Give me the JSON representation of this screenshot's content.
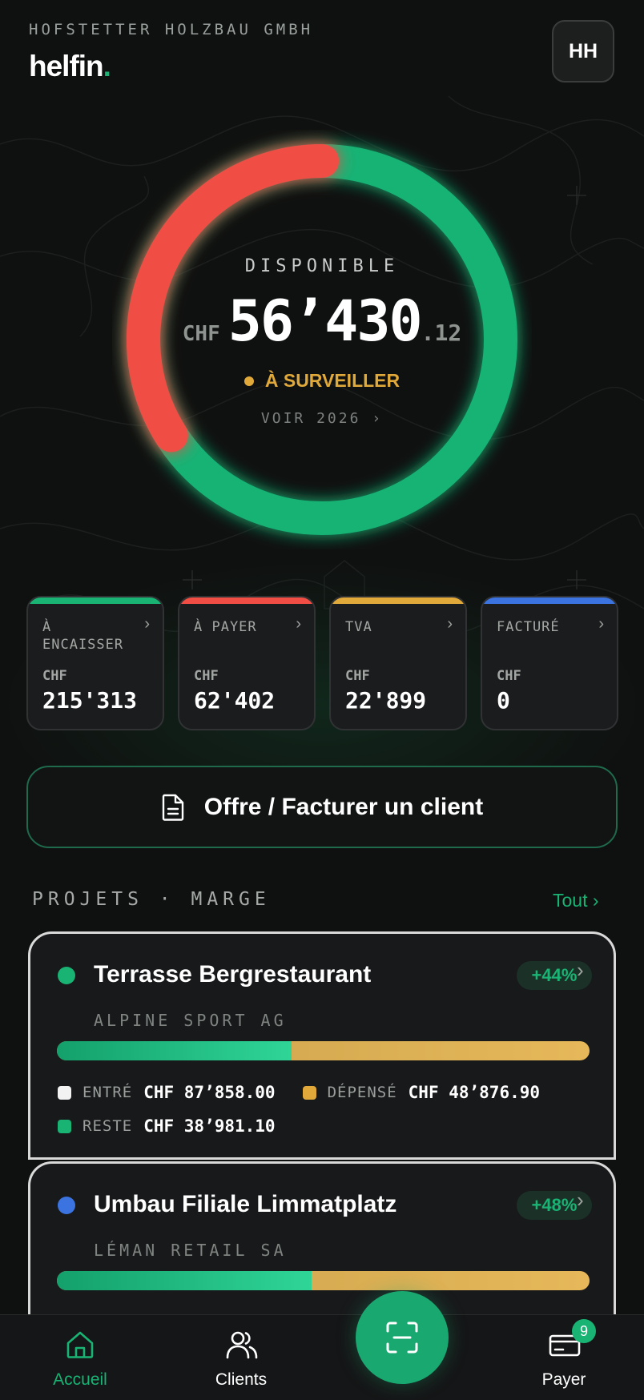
{
  "header": {
    "company": "HOFSTETTER HOLZBAU GMBH",
    "brand": "helfin",
    "brand_dot": ".",
    "avatar_initials": "HH"
  },
  "balance": {
    "label": "DISPONIBLE",
    "currency": "CHF",
    "amount_int": "56’430",
    "amount_dec": ".12",
    "status": "À SURVEILLER",
    "link": "VOIR 2026 ›",
    "ring_red_fraction": 0.34,
    "colors": {
      "red": "#f04e45",
      "green": "#19b374",
      "status": "#e0a93a"
    }
  },
  "stats": [
    {
      "label": "À ENCAISSER",
      "currency": "CHF",
      "value": "215'313",
      "color": "#19b374"
    },
    {
      "label": "À PAYER",
      "currency": "CHF",
      "value": "62'402",
      "color": "#f04e45"
    },
    {
      "label": "TVA",
      "currency": "CHF",
      "value": "22'899",
      "color": "#e0a93a"
    },
    {
      "label": "FACTURÉ",
      "currency": "CHF",
      "value": "0",
      "color": "#3b74e0"
    }
  ],
  "stat_chevron": "›",
  "cta": {
    "label": "Offre / Facturer un client",
    "icon": "document-icon"
  },
  "section": {
    "title": "PROJETS · MARGE",
    "link": "Tout ›"
  },
  "projects": [
    {
      "name": "Terrasse Bergrestaurant",
      "client": "ALPINE SPORT AG",
      "margin": "+44%",
      "dot_color": "#19b374",
      "progress": 0.44,
      "entered_label": "ENTRÉ",
      "entered": "CHF 87’858.00",
      "spent_label": "DÉPENSÉ",
      "spent": "CHF 48’876.90",
      "rest_label": "RESTE",
      "rest": "CHF 38’981.10"
    },
    {
      "name": "Umbau Filiale Limmatplatz",
      "client": "LÉMAN RETAIL SA",
      "margin": "+48%",
      "dot_color": "#3b74e0",
      "progress": 0.478
    }
  ],
  "nav": {
    "home": "Accueil",
    "clients": "Clients",
    "pay": "Payer",
    "pay_badge": "9",
    "active_color": "#19b374"
  }
}
